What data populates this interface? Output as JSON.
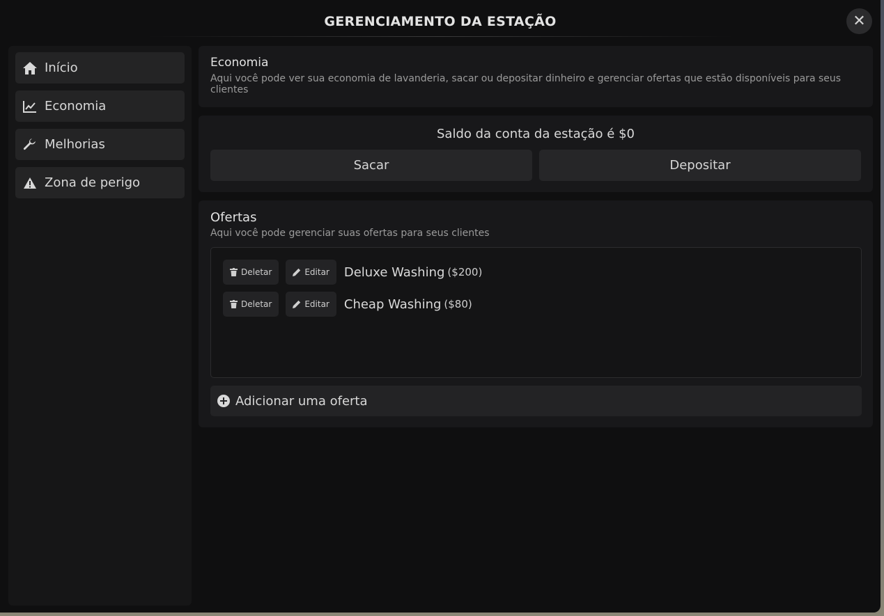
{
  "window": {
    "title": "GERENCIAMENTO DA ESTAÇÃO",
    "close_icon": "close-icon"
  },
  "sidebar": {
    "items": [
      {
        "label": "Início",
        "icon": "home-icon"
      },
      {
        "label": "Economia",
        "icon": "line-chart-icon"
      },
      {
        "label": "Melhorias",
        "icon": "wrench-icon"
      },
      {
        "label": "Zona de perigo",
        "icon": "warning-icon"
      }
    ]
  },
  "economy": {
    "heading": "Economia",
    "description": "Aqui você pode ver sua economia de lavanderia, sacar ou depositar dinheiro e gerenciar ofertas que estão disponíveis para seus clientes"
  },
  "balance": {
    "text": "Saldo da conta da estação é $0",
    "withdraw_label": "Sacar",
    "deposit_label": "Depositar"
  },
  "offers": {
    "heading": "Ofertas",
    "description": "Aqui você pode gerenciar suas ofertas para seus clientes",
    "delete_label": "Deletar",
    "edit_label": "Editar",
    "items": [
      {
        "name": "Deluxe Washing",
        "price": "($200)"
      },
      {
        "name": "Cheap Washing",
        "price": "($80)"
      }
    ],
    "add_label": "Adicionar uma oferta"
  },
  "colors": {
    "window_bg": "#0f0f10",
    "panel_bg": "#18181a",
    "button_bg": "#262628",
    "text": "#d6d6d6",
    "muted_text": "#9b9b9b"
  }
}
